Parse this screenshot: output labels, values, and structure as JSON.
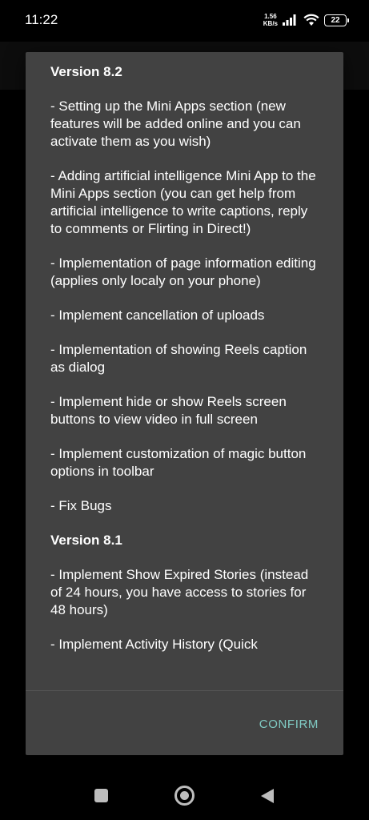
{
  "status_bar": {
    "time": "11:22",
    "net_speed_value": "1.56",
    "net_speed_unit": "KB/s",
    "battery_level": "22",
    "icons": [
      "signal-icon",
      "wifi-icon",
      "battery-icon"
    ]
  },
  "dialog": {
    "sections": [
      {
        "version": "Version 8.2",
        "items": [
          "- Setting up the Mini Apps section (new features will be added online and you can activate them as you wish)",
          "- Adding artificial intelligence Mini App to the Mini Apps section (you can get help from artificial intelligence to write captions, reply to comments or Flirting in Direct!)",
          "- Implementation of page information editing (applies only localy on your phone)",
          "- Implement cancellation of uploads",
          "- Implementation of showing Reels caption as dialog",
          "- Implement hide or show Reels screen buttons to view video in full screen",
          "- Implement customization of magic button options in toolbar",
          "- Fix Bugs"
        ]
      },
      {
        "version": "Version 8.1",
        "items": [
          "- Implement Show Expired Stories (instead of 24 hours, you have access to stories for 48 hours)",
          "- Implement Activity History (Quick"
        ]
      }
    ],
    "confirm_label": "CONFIRM"
  },
  "colors": {
    "dialog_background": "#424242",
    "accent": "#80cbc4",
    "screen_background": "#000000"
  },
  "nav_bar": {
    "icons": [
      "recents-icon",
      "home-icon",
      "back-icon"
    ]
  }
}
